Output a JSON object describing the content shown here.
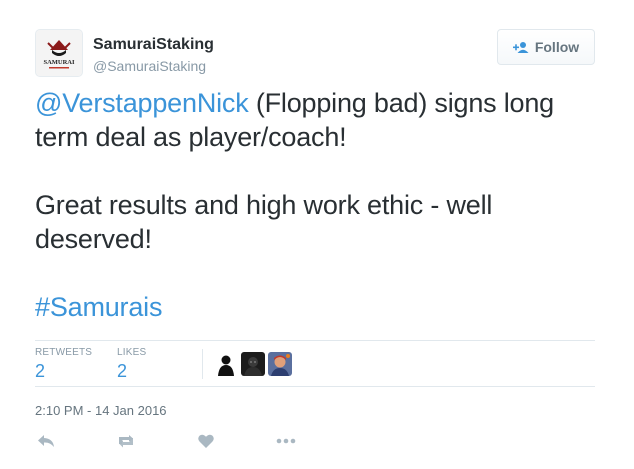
{
  "author": {
    "display_name": "SamuraiStaking",
    "screen_name": "@SamuraiStaking",
    "avatar_icon": "samurai-logo",
    "avatar_logo_text": "SAMURAI"
  },
  "follow_button": {
    "label": "Follow",
    "icon": "add-user-icon"
  },
  "tweet": {
    "mention": "@VerstappenNick",
    "line1_rest": " (Flopping bad) signs long term deal as player/coach!",
    "paragraph2": "Great results and high work ethic - well deserved!",
    "hashtag": "#Samurais"
  },
  "stats": {
    "retweets_label": "RETWEETS",
    "retweets_count": "2",
    "likes_label": "LIKES",
    "likes_count": "2"
  },
  "likers": [
    {
      "icon": "user-avatar-1"
    },
    {
      "icon": "user-avatar-2"
    },
    {
      "icon": "user-avatar-3"
    }
  ],
  "timestamp": "2:10 PM - 14 Jan 2016",
  "actions": [
    {
      "icon": "reply-icon"
    },
    {
      "icon": "retweet-icon"
    },
    {
      "icon": "like-heart-icon"
    },
    {
      "icon": "more-dots-icon"
    }
  ],
  "colors": {
    "link": "#3b94d9",
    "text": "#292f33",
    "muted": "#8899a6",
    "icon": "#aab8c2",
    "divider": "#e1e8ed"
  }
}
